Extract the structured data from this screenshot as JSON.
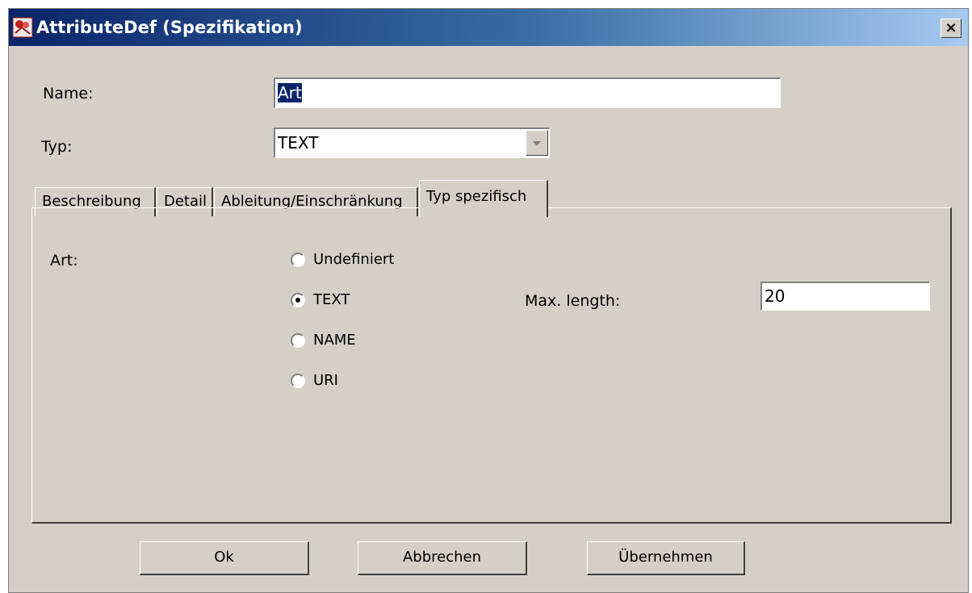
{
  "window": {
    "title": "AttributeDef (Spezifikation)",
    "close_glyph": "×",
    "app_icon": "attribute-app-icon",
    "close_icon": "close-icon"
  },
  "form": {
    "name_label": "Name:",
    "name_value": "Art",
    "type_label": "Typ:",
    "type_value": "TEXT"
  },
  "tabs": [
    {
      "label": "Beschreibung"
    },
    {
      "label": "Detail"
    },
    {
      "label": "Ableitung/Einschränkung"
    },
    {
      "label": "Typ spezifisch",
      "active": true
    }
  ],
  "panel": {
    "art_label": "Art:",
    "options": [
      {
        "label": "Undefiniert",
        "checked": false
      },
      {
        "label": "TEXT",
        "checked": true
      },
      {
        "label": "NAME",
        "checked": false
      },
      {
        "label": "URI",
        "checked": false
      }
    ],
    "maxlength_label": "Max. length:",
    "maxlength_value": "20"
  },
  "buttons": {
    "ok": "Ok",
    "cancel": "Abbrechen",
    "apply": "Übernehmen"
  }
}
